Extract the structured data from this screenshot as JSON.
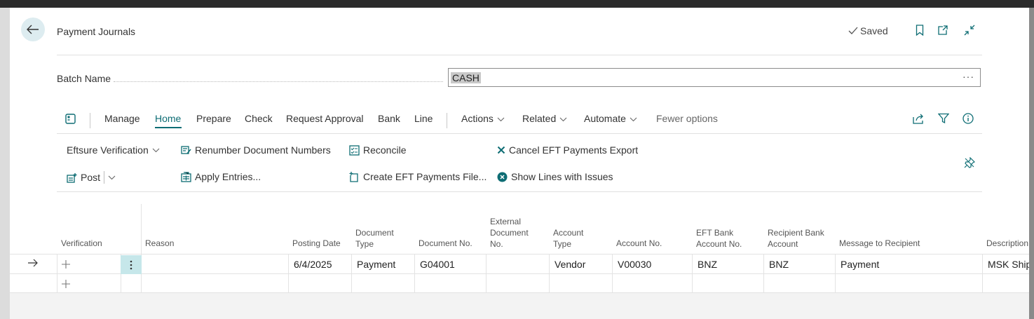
{
  "header": {
    "title": "Payment Journals",
    "saved_label": "Saved"
  },
  "batch": {
    "label": "Batch Name",
    "value": "CASH",
    "lookup": "···"
  },
  "menu": {
    "manage": "Manage",
    "home": "Home",
    "prepare": "Prepare",
    "check": "Check",
    "request_approval": "Request Approval",
    "bank": "Bank",
    "line": "Line",
    "actions": "Actions",
    "related": "Related",
    "automate": "Automate",
    "fewer_options": "Fewer options"
  },
  "actions": {
    "eftsure_verification": "Eftsure Verification",
    "renumber": "Renumber Document Numbers",
    "reconcile": "Reconcile",
    "cancel_eft": "Cancel EFT Payments Export",
    "post": "Post",
    "apply_entries": "Apply Entries...",
    "create_eft": "Create EFT Payments File...",
    "show_lines": "Show Lines with Issues"
  },
  "grid": {
    "columns": {
      "verification": "Verification",
      "reason": "Reason",
      "posting_date": "Posting Date",
      "document_type_1": "Document",
      "document_type_2": "Type",
      "document_no": "Document No.",
      "external_1": "External",
      "external_2": "Document",
      "external_3": "No.",
      "account_type_1": "Account",
      "account_type_2": "Type",
      "account_no": "Account No.",
      "eft_bank_1": "EFT Bank",
      "eft_bank_2": "Account No.",
      "recipient_bank_1": "Recipient Bank",
      "recipient_bank_2": "Account",
      "message": "Message to Recipient",
      "description": "Description"
    },
    "row1": {
      "posting_date": "6/4/2025",
      "document_type": "Payment",
      "document_no": "G04001",
      "account_type": "Vendor",
      "account_no": "V00030",
      "eft_bank": "BNZ",
      "recipient_bank": "BNZ",
      "message": "Payment",
      "description": "MSK Shipping"
    }
  },
  "colors": {
    "accent": "#0e6d74",
    "back_button_bg": "#ddecf0",
    "selected_cell_bg": "#c6e7ea"
  }
}
